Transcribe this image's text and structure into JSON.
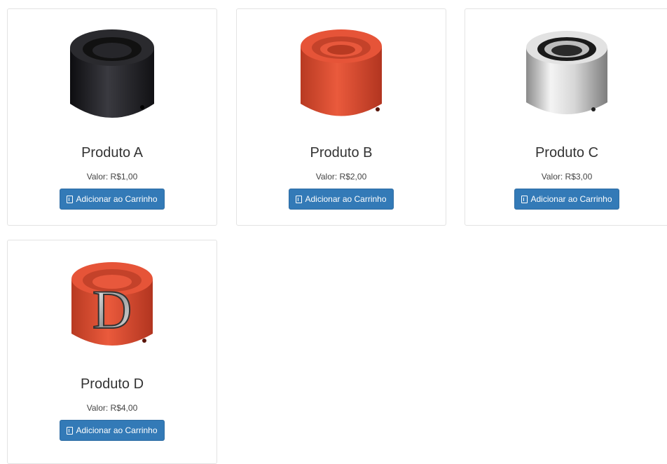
{
  "products": [
    {
      "name": "Produto A",
      "price": "Valor: R$1,00",
      "button_label": "Adicionar ao Carrinho",
      "color": "#1e1e22",
      "letter": ""
    },
    {
      "name": "Produto B",
      "price": "Valor: R$2,00",
      "button_label": "Adicionar ao Carrinho",
      "color": "#d84a30",
      "letter": ""
    },
    {
      "name": "Produto C",
      "price": "Valor: R$3,00",
      "button_label": "Adicionar ao Carrinho",
      "color": "#c9c9c9",
      "letter": ""
    },
    {
      "name": "Produto D",
      "price": "Valor: R$4,00",
      "button_label": "Adicionar ao Carrinho",
      "color": "#d84a30",
      "letter": "D"
    }
  ],
  "icons": {
    "button_icon": "book-icon",
    "product_image": "knob-cap-image"
  },
  "colors": {
    "button": "#337ab7",
    "border": "#e3e3e3"
  }
}
